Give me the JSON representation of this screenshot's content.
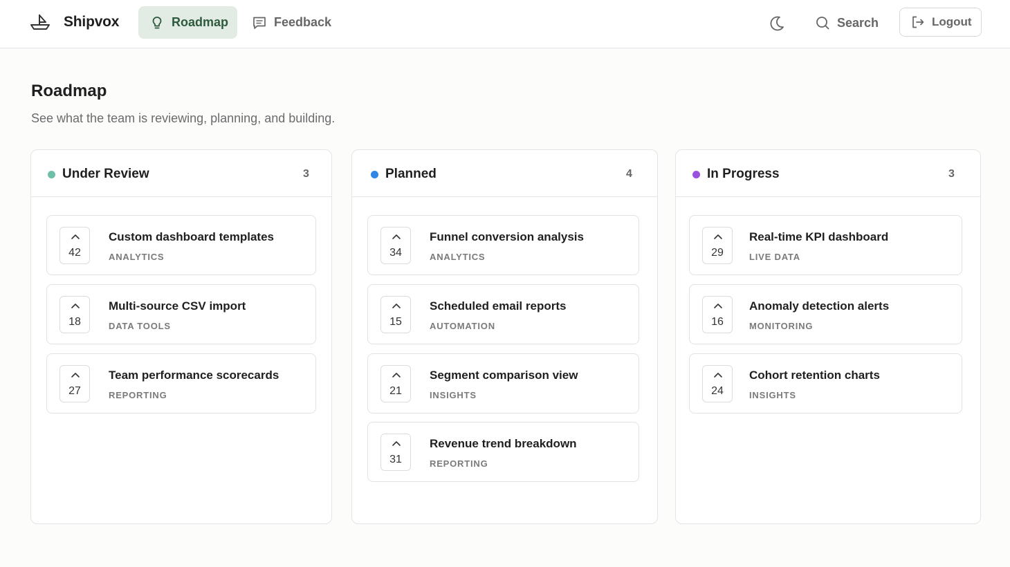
{
  "app": {
    "name": "Shipvox"
  },
  "nav": {
    "tabs": [
      {
        "label": "Roadmap",
        "icon": "lightbulb-icon",
        "active": true
      },
      {
        "label": "Feedback",
        "icon": "message-icon",
        "active": false
      }
    ],
    "search_label": "Search",
    "logout_label": "Logout"
  },
  "page": {
    "title": "Roadmap",
    "subtitle": "See what the team is reviewing, planning, and building."
  },
  "colors": {
    "accent": "#2d5a3d",
    "under_review": "#6fbfa8",
    "planned": "#2f86e6",
    "in_progress": "#9b51e0"
  },
  "columns": [
    {
      "title": "Under Review",
      "count": "3",
      "cards": [
        {
          "votes": "42",
          "title": "Custom dashboard templates",
          "tag": "ANALYTICS"
        },
        {
          "votes": "18",
          "title": "Multi-source CSV import",
          "tag": "DATA TOOLS"
        },
        {
          "votes": "27",
          "title": "Team performance scorecards",
          "tag": "REPORTING"
        }
      ]
    },
    {
      "title": "Planned",
      "count": "4",
      "cards": [
        {
          "votes": "34",
          "title": "Funnel conversion analysis",
          "tag": "ANALYTICS"
        },
        {
          "votes": "15",
          "title": "Scheduled email reports",
          "tag": "AUTOMATION"
        },
        {
          "votes": "21",
          "title": "Segment comparison view",
          "tag": "INSIGHTS"
        },
        {
          "votes": "31",
          "title": "Revenue trend breakdown",
          "tag": "REPORTING"
        }
      ]
    },
    {
      "title": "In Progress",
      "count": "3",
      "cards": [
        {
          "votes": "29",
          "title": "Real-time KPI dashboard",
          "tag": "LIVE DATA"
        },
        {
          "votes": "16",
          "title": "Anomaly detection alerts",
          "tag": "MONITORING"
        },
        {
          "votes": "24",
          "title": "Cohort retention charts",
          "tag": "INSIGHTS"
        }
      ]
    }
  ]
}
